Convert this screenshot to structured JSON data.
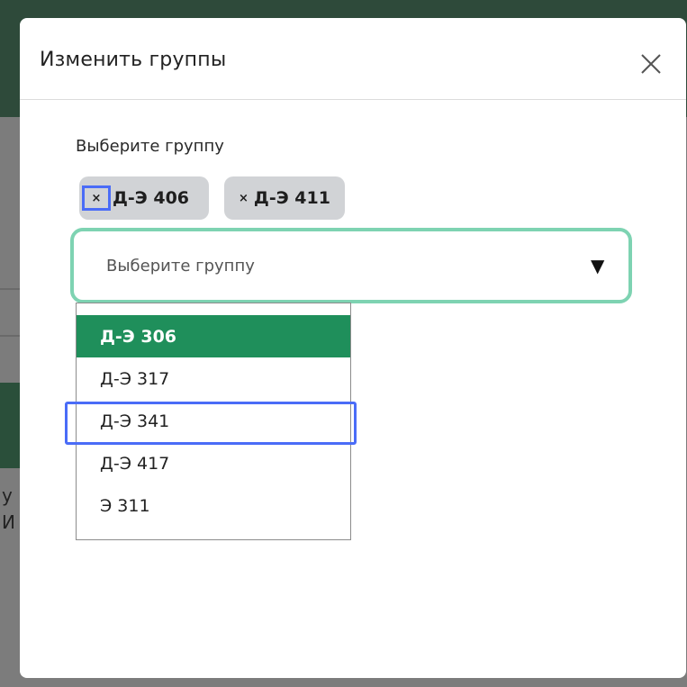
{
  "dialog": {
    "title": "Изменить группы",
    "close_icon": "close-icon"
  },
  "group_field": {
    "label": "Выберите группу",
    "placeholder": "Выберите группу",
    "arrow_icon": "triangle-down-icon"
  },
  "selected_chips": [
    {
      "remove": "×",
      "label": "Д-Э 406"
    },
    {
      "remove": "×",
      "label": "Д-Э 411"
    }
  ],
  "options": [
    {
      "label": "Д-Э 306",
      "selected": true
    },
    {
      "label": "Д-Э 317",
      "selected": false
    },
    {
      "label": "Д-Э 341",
      "selected": false
    },
    {
      "label": "Д-Э 417",
      "selected": false
    },
    {
      "label": "Э 311",
      "selected": false
    }
  ],
  "background_fragments": [
    "у",
    "И"
  ],
  "colors": {
    "accent_green": "#1f8f5b",
    "focus_border": "#7ed3b2",
    "highlight_blue": "#4a6cf7",
    "chip_bg": "#d1d3d6"
  }
}
